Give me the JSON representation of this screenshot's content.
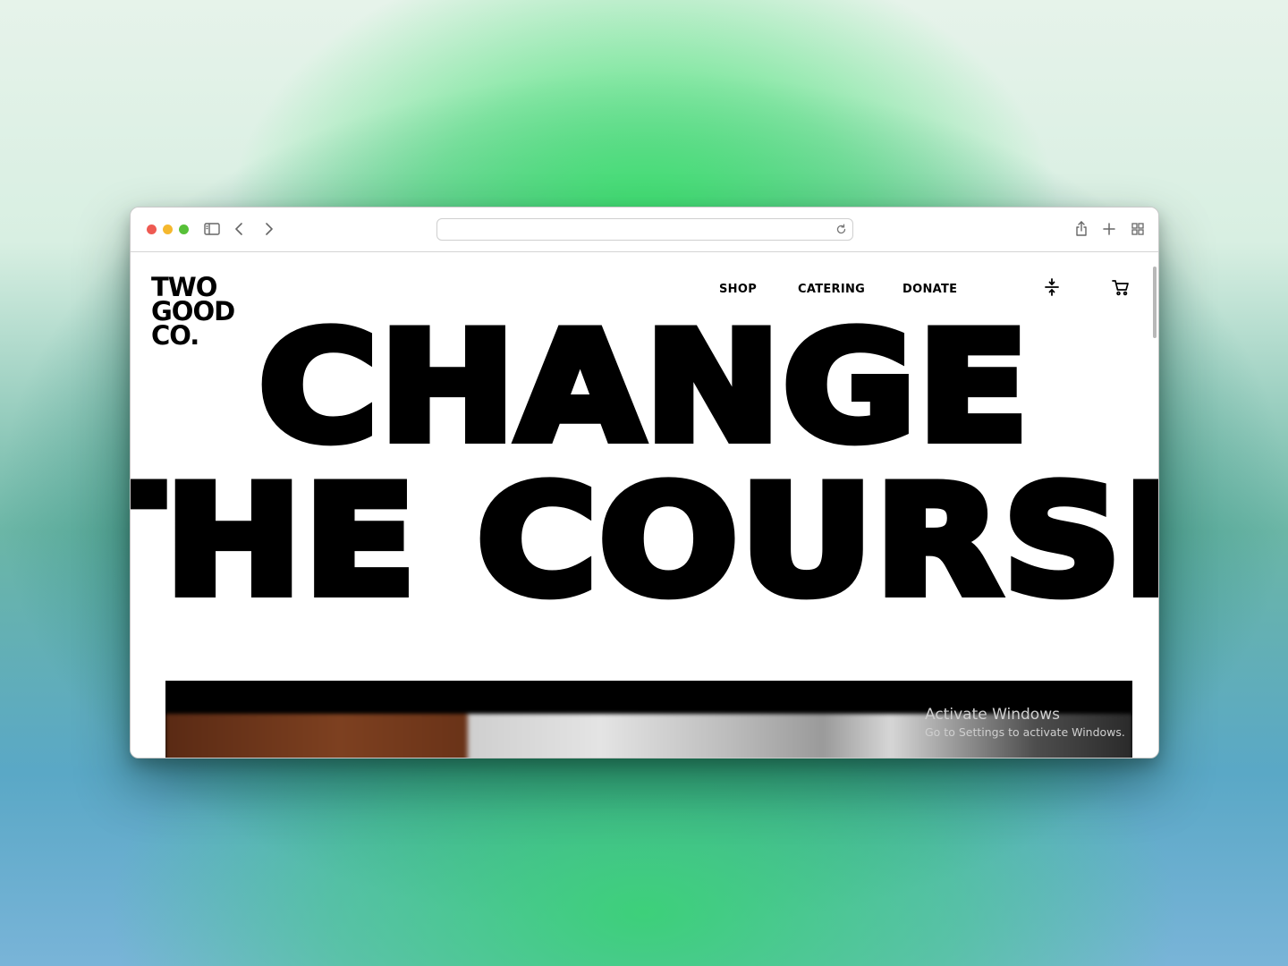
{
  "browser": {
    "address_value": "",
    "icons": [
      "sidebar-icon",
      "back-icon",
      "forward-icon",
      "reload-icon",
      "share-icon",
      "new-tab-icon",
      "tab-overview-icon"
    ]
  },
  "site": {
    "logo_lines": [
      "TWO",
      "GOOD",
      "CO."
    ],
    "nav": [
      {
        "label": "SHOP"
      },
      {
        "label": "CATERING"
      },
      {
        "label": "DONATE"
      }
    ],
    "nav_icons": [
      "menu-toggle-icon",
      "cart-icon"
    ]
  },
  "hero": {
    "line1": "CHANGE",
    "line2": "THE COURSE"
  },
  "watermark": {
    "title": "Activate Windows",
    "subtitle": "Go to Settings to activate Windows."
  },
  "colors": {
    "text": "#000000",
    "page_bg": "#ffffff",
    "traffic_red": "#ee5a52",
    "traffic_yellow": "#f5b82e",
    "traffic_green": "#57c038"
  }
}
